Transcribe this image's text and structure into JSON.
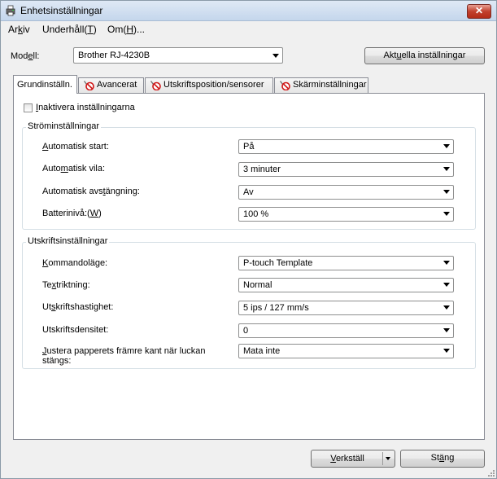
{
  "window": {
    "title": "Enhetsinställningar",
    "close_label": "✕"
  },
  "menu": {
    "items": [
      {
        "pre": "Ar",
        "key": "k",
        "post": "iv"
      },
      {
        "pre": "Underhåll(",
        "key": "T",
        "post": ")"
      },
      {
        "pre": "Om(",
        "key": "H",
        "post": ")..."
      }
    ]
  },
  "model": {
    "label_pre": "Mod",
    "label_key": "e",
    "label_post": "ll:",
    "value": "Brother RJ-4230B",
    "current_settings_pre": "Akt",
    "current_settings_key": "u",
    "current_settings_post": "ella inställningar"
  },
  "tabs": [
    {
      "label": "Grundinställn.",
      "icon": "none"
    },
    {
      "label": "Avancerat",
      "icon": "wrench-no-icon"
    },
    {
      "label": "Utskriftsposition/sensorer",
      "icon": "wrench-no-icon"
    },
    {
      "label": "Skärminställningar",
      "icon": "wrench-no-icon"
    }
  ],
  "disable_settings": {
    "pre": "",
    "key": "I",
    "post": "naktivera inställningarna",
    "checked": false
  },
  "power": {
    "title": "Ströminställningar",
    "rows": [
      {
        "pre": "",
        "key": "A",
        "post": "utomatisk start:",
        "value": "På"
      },
      {
        "pre": "Auto",
        "key": "m",
        "post": "atisk vila:",
        "value": "3 minuter"
      },
      {
        "pre": "Automatisk avs",
        "key": "t",
        "post": "ängning:",
        "value": "Av"
      },
      {
        "pre": "Batterinivå:(",
        "key": "W",
        "post": ")",
        "value": "100 %"
      }
    ]
  },
  "print": {
    "title": "Utskriftsinställningar",
    "rows": [
      {
        "pre": "",
        "key": "K",
        "post": "ommandoläge:",
        "value": "P-touch Template"
      },
      {
        "pre": "Te",
        "key": "x",
        "post": "triktning:",
        "value": "Normal"
      },
      {
        "pre": "Ut",
        "key": "s",
        "post": "kriftshastighet:",
        "value": "5 ips / 127 mm/s"
      },
      {
        "pre": "Utskriftsdensitet:",
        "key": "",
        "post": "",
        "value": "0"
      },
      {
        "pre": "",
        "key": "J",
        "post": "ustera papperets främre kant när luckan",
        "line2": "stängs:",
        "value": "Mata inte"
      }
    ]
  },
  "footer": {
    "apply_pre": "",
    "apply_key": "V",
    "apply_post": "erkställ",
    "close_pre": "St",
    "close_key": "ä",
    "close_post": "ng"
  }
}
